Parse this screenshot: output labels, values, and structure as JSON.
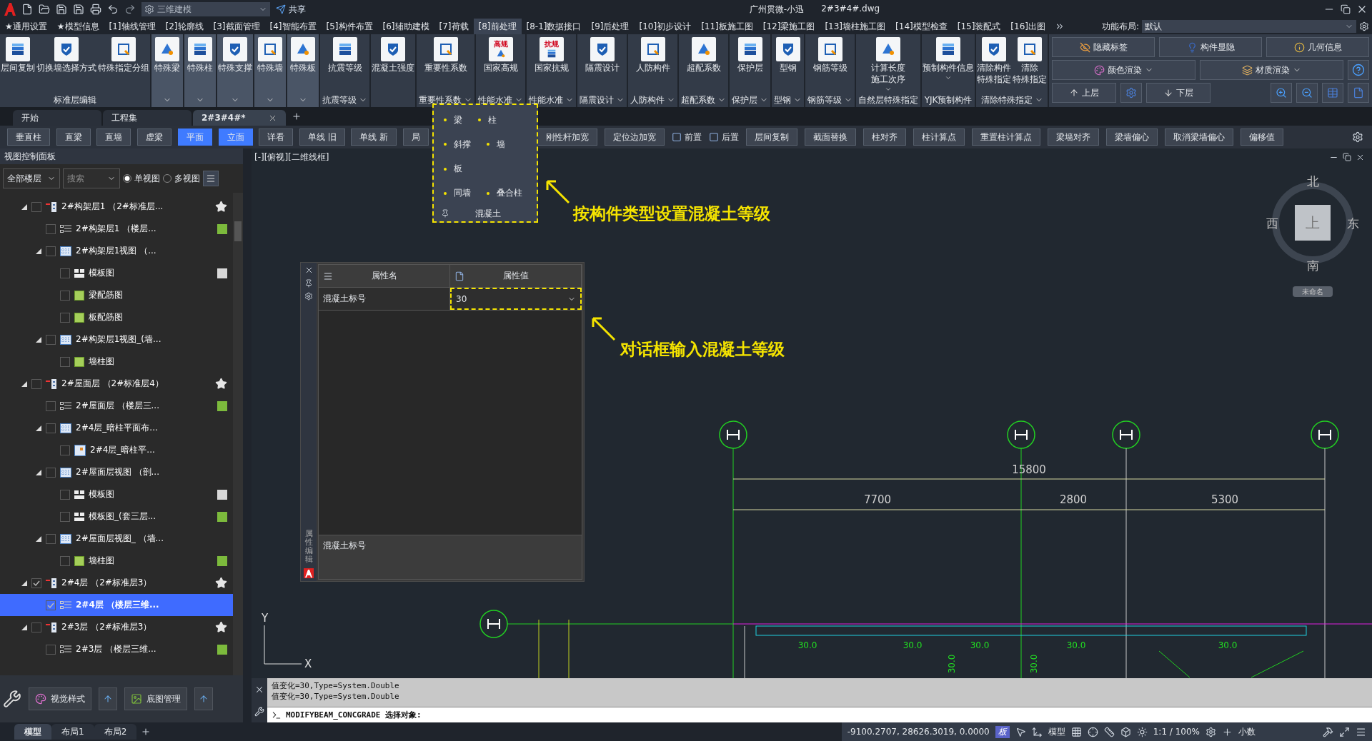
{
  "title_bar": {
    "workspace": "三维建模",
    "share": "共享",
    "app": "广州贯微-小迅",
    "file": "2#3#4#.dwg"
  },
  "menu_tabs": [
    {
      "label": "★通用设置",
      "selected": false
    },
    {
      "label": "★模型信息",
      "selected": false
    },
    {
      "label": "[1]轴线管理",
      "selected": false
    },
    {
      "label": "[2]轮廓线",
      "selected": false
    },
    {
      "label": "[3]截面管理",
      "selected": false
    },
    {
      "label": "[4]智能布置",
      "selected": false
    },
    {
      "label": "[5]构件布置",
      "selected": false
    },
    {
      "label": "[6]辅助建模",
      "selected": false
    },
    {
      "label": "[7]荷载",
      "selected": false
    },
    {
      "label": "[8]前处理",
      "selected": true
    },
    {
      "label": "[8-1]数据接口",
      "selected": false
    },
    {
      "label": "[9]后处理",
      "selected": false
    },
    {
      "label": "[10]初步设计",
      "selected": false
    },
    {
      "label": "[11]板施工图",
      "selected": false
    },
    {
      "label": "[12]梁施工图",
      "selected": false
    },
    {
      "label": "[13]墙柱施工图",
      "selected": false
    },
    {
      "label": "[14]模型检查",
      "selected": false
    },
    {
      "label": "[15]装配式",
      "selected": false
    },
    {
      "label": "[16]出图",
      "selected": false
    }
  ],
  "layout_selector": {
    "label": "功能布局:",
    "value": "默认"
  },
  "ribbon": [
    {
      "label": "标准层编辑",
      "caret": false,
      "shaded": false,
      "buttons": [
        {
          "label": "层间复制",
          "caret": false
        },
        {
          "label": "切换墙选择方式",
          "caret": false
        },
        {
          "label": "特殊指定分组",
          "caret": false
        }
      ]
    },
    {
      "caret": true,
      "shaded": true,
      "buttons": [
        {
          "label": "特殊梁",
          "caret": false
        }
      ]
    },
    {
      "caret": true,
      "shaded": true,
      "buttons": [
        {
          "label": "特殊柱",
          "caret": false
        }
      ]
    },
    {
      "caret": true,
      "shaded": true,
      "buttons": [
        {
          "label": "特殊支撑",
          "caret": false
        }
      ]
    },
    {
      "caret": true,
      "shaded": true,
      "buttons": [
        {
          "label": "特殊墙",
          "caret": false
        }
      ]
    },
    {
      "caret": true,
      "shaded": true,
      "buttons": [
        {
          "label": "特殊板",
          "caret": false
        }
      ]
    },
    {
      "label": "抗震等级",
      "caret": true,
      "shaded": false,
      "buttons": [
        {
          "label": "抗震等级",
          "caret": false
        }
      ]
    },
    {
      "caret": false,
      "shaded": false,
      "buttons": [
        {
          "label": "混凝土强度",
          "caret": false
        }
      ]
    },
    {
      "label": "重要性系数",
      "caret": true,
      "shaded": false,
      "buttons": [
        {
          "label": "重要性系数",
          "caret": false
        }
      ]
    },
    {
      "label": "性能水准",
      "caret": true,
      "shaded": false,
      "buttons": [
        {
          "label": "国家高规",
          "caret": false,
          "icon_text": "高规"
        }
      ]
    },
    {
      "label": "性能水准",
      "caret": true,
      "shaded": false,
      "buttons": [
        {
          "label": "国家抗规",
          "caret": false,
          "icon_text": "抗规"
        }
      ]
    },
    {
      "label": "隔震设计",
      "caret": true,
      "shaded": false,
      "buttons": [
        {
          "label": "隔震设计",
          "caret": false
        }
      ]
    },
    {
      "label": "人防构件",
      "caret": true,
      "shaded": false,
      "buttons": [
        {
          "label": "人防构件",
          "caret": false
        }
      ]
    },
    {
      "label": "超配系数",
      "caret": true,
      "shaded": false,
      "buttons": [
        {
          "label": "超配系数",
          "caret": false
        }
      ]
    },
    {
      "label": "保护层",
      "caret": true,
      "shaded": false,
      "buttons": [
        {
          "label": "保护层",
          "caret": false
        }
      ]
    },
    {
      "label": "型钢",
      "caret": true,
      "shaded": false,
      "buttons": [
        {
          "label": "型钢",
          "caret": false
        }
      ]
    },
    {
      "label": "钢筋等级",
      "caret": true,
      "shaded": false,
      "buttons": [
        {
          "label": "钢筋等级",
          "caret": false
        }
      ]
    },
    {
      "label": "自然层特殊指定",
      "caret": false,
      "shaded": false,
      "buttons": [
        {
          "lines": [
            "计算长度",
            "施工次序"
          ],
          "caret": true
        }
      ]
    },
    {
      "label": "YJK预制构件",
      "caret": false,
      "shaded": false,
      "buttons": [
        {
          "label": "预制构件信息",
          "caret": true
        }
      ]
    },
    {
      "label": "清除特殊指定",
      "caret": true,
      "shaded": false,
      "buttons": [
        {
          "lines": [
            "清除构件",
            "特殊指定"
          ],
          "caret": false
        },
        {
          "lines": [
            "清除",
            "特殊指定"
          ],
          "caret": false
        }
      ]
    }
  ],
  "ribbon_side": {
    "display_buttons": [
      "隐藏标签",
      "构件显隐",
      "几何信息"
    ],
    "render_buttons": [
      "颜色渲染",
      "材质渲染"
    ],
    "floor_buttons": [
      "上层",
      "下层"
    ]
  },
  "doc_tabs": [
    {
      "label": "开始",
      "selected": false
    },
    {
      "label": "工程集",
      "selected": false
    },
    {
      "label": "2#3#4#*",
      "selected": true
    }
  ],
  "toolbar": {
    "left": [
      {
        "label": "垂直柱",
        "selected": false
      },
      {
        "label": "直梁",
        "selected": false
      },
      {
        "label": "直墙",
        "selected": false
      },
      {
        "label": "虚梁",
        "selected": false
      },
      {
        "label": "平面",
        "selected": true
      },
      {
        "label": "立面",
        "selected": true
      },
      {
        "label": "详看",
        "selected": false
      },
      {
        "label": "单线 旧",
        "selected": false
      },
      {
        "label": "单线 新",
        "selected": false
      },
      {
        "label": "局",
        "selected": false
      }
    ],
    "right": [
      {
        "label": "刚性杆加宽",
        "kind": "button"
      },
      {
        "label": "定位边加宽",
        "kind": "button"
      },
      {
        "label": "前置",
        "kind": "toggle"
      },
      {
        "label": "后置",
        "kind": "toggle"
      },
      {
        "label": "层间复制",
        "kind": "button"
      },
      {
        "label": "截面替换",
        "kind": "button"
      },
      {
        "label": "柱对齐",
        "kind": "button"
      },
      {
        "label": "柱计算点",
        "kind": "button"
      },
      {
        "label": "重置柱计算点",
        "kind": "button"
      },
      {
        "label": "梁墙对齐",
        "kind": "button"
      },
      {
        "label": "梁墙偏心",
        "kind": "button"
      },
      {
        "label": "取消梁墙偏心",
        "kind": "button"
      },
      {
        "label": "偏移值",
        "kind": "button"
      }
    ]
  },
  "concrete_popup": {
    "rows": [
      [
        "梁",
        "柱"
      ],
      [
        "斜撑",
        "墙"
      ],
      [
        "板"
      ],
      [
        "同墙",
        "叠合柱"
      ]
    ],
    "footer": "混凝土"
  },
  "annotations": [
    "按构件类型设置混凝土等级",
    "对话框输入混凝土等级"
  ],
  "left_panel": {
    "title": "视图控制面板",
    "floor_filter": "全部楼层",
    "search_placeholder": "搜索",
    "view_modes": [
      {
        "label": "单视图",
        "selected": true
      },
      {
        "label": "多视图",
        "selected": false
      }
    ],
    "tree": [
      {
        "label": "2#构架层1 （2#标准层...",
        "kind": "floor",
        "checked": false,
        "selected": false,
        "star": true,
        "children": [
          {
            "label": "2#构架层1 （楼层...",
            "kind": "list",
            "checked": false,
            "selected": false,
            "star": false,
            "color": "#7cba3c"
          },
          {
            "label": "2#构架层1视图 （...",
            "kind": "view",
            "checked": false,
            "selected": false,
            "star": false,
            "children": [
              {
                "label": "模板图",
                "kind": "plan",
                "checked": false,
                "selected": false,
                "star": false,
                "color": "#d8d8d8"
              },
              {
                "label": "梁配筋图",
                "kind": "leaf",
                "checked": false,
                "selected": false,
                "star": false
              },
              {
                "label": "板配筋图",
                "kind": "leaf",
                "checked": false,
                "selected": false,
                "star": false
              }
            ]
          },
          {
            "label": "2#构架层1视图_(墙...",
            "kind": "view",
            "checked": false,
            "selected": false,
            "star": false,
            "children": [
              {
                "label": "墙柱图",
                "kind": "leaf",
                "checked": false,
                "selected": false,
                "star": false
              }
            ]
          }
        ]
      },
      {
        "label": "2#屋面层 （2#标准层4）",
        "kind": "floor",
        "checked": false,
        "selected": false,
        "star": true,
        "children": [
          {
            "label": "2#屋面层 （楼层三...",
            "kind": "list",
            "checked": false,
            "selected": false,
            "star": false,
            "color": "#7cba3c"
          },
          {
            "label": "2#4层_暗柱平面布...",
            "kind": "view",
            "checked": false,
            "selected": false,
            "star": false,
            "children": [
              {
                "label": "2#4层_暗柱平...",
                "kind": "detail",
                "checked": false,
                "selected": false,
                "star": false
              }
            ]
          },
          {
            "label": "2#屋面层视图 （剖...",
            "kind": "view",
            "checked": false,
            "selected": false,
            "star": false,
            "children": [
              {
                "label": "模板图",
                "kind": "plan",
                "checked": false,
                "selected": false,
                "star": false,
                "color": "#d8d8d8"
              },
              {
                "label": "模板图_(套三层...",
                "kind": "plan",
                "checked": false,
                "selected": false,
                "star": false,
                "color": "#7cba3c"
              }
            ]
          },
          {
            "label": "2#屋面层视图_ （墙...",
            "kind": "view",
            "checked": false,
            "selected": false,
            "star": false,
            "children": [
              {
                "label": "墙柱图",
                "kind": "leaf",
                "checked": false,
                "selected": false,
                "star": false,
                "color": "#7cba3c"
              }
            ]
          }
        ]
      },
      {
        "label": "2#4层 （2#标准层3）",
        "kind": "floor",
        "checked": true,
        "selected": false,
        "star": true,
        "children": [
          {
            "label": "2#4层 （楼层三维...",
            "kind": "list",
            "checked": true,
            "selected": true,
            "star": false
          }
        ]
      },
      {
        "label": "2#3层 （2#标准层3）",
        "kind": "floor",
        "checked": false,
        "selected": false,
        "star": true,
        "children": [
          {
            "label": "2#3层 （楼层三维...",
            "kind": "list",
            "checked": false,
            "selected": false,
            "star": false,
            "color": "#7cba3c"
          }
        ]
      }
    ],
    "bottom_buttons": [
      "视觉样式",
      "底图管理"
    ]
  },
  "canvas": {
    "view_label": "[-][俯视][二维线框]",
    "compass": {
      "north": "北",
      "south": "南",
      "west": "西",
      "east": "东",
      "top": "上",
      "ucs": "未命名"
    },
    "total_dimension": "15800",
    "span_dimensions": [
      "7700",
      "2800",
      "5300"
    ],
    "beam_labels": [
      "30.0",
      "30.0",
      "30.0",
      "30.0",
      "30.0"
    ],
    "column_labels": [
      "30.0",
      "30.0"
    ],
    "axis_y": "Y",
    "axis_x": "X"
  },
  "properties": {
    "columns": [
      "属性名",
      "属性值"
    ],
    "rows": [
      {
        "name": "混凝土标号",
        "value": "30",
        "highlighted": true
      }
    ],
    "description": "混凝土标号",
    "side_label": "属性编辑"
  },
  "command": {
    "history": [
      "值变化=30,Type=System.Double",
      "值变化=30,Type=System.Double"
    ],
    "prompt": "MODIFYBEAM_CONCGRADE 选择对象:"
  },
  "layout_tabs": [
    {
      "label": "模型",
      "selected": true
    },
    {
      "label": "布局1",
      "selected": false
    },
    {
      "label": "布局2",
      "selected": false
    }
  ],
  "status_bar": {
    "coordinates": "-9100.2707, 28626.3019, 0.0000",
    "plate": "板",
    "space": "模型",
    "scale": "1:1 / 100%",
    "units": "小数"
  }
}
